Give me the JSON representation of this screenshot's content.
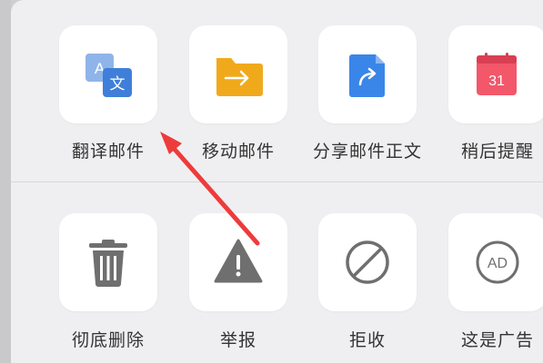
{
  "actions_row1": [
    {
      "label": "翻译邮件",
      "icon": "translate-icon"
    },
    {
      "label": "移动邮件",
      "icon": "move-folder-icon"
    },
    {
      "label": "分享邮件正文",
      "icon": "share-document-icon"
    },
    {
      "label": "稍后提醒",
      "icon": "calendar-icon"
    }
  ],
  "actions_row2": [
    {
      "label": "彻底删除",
      "icon": "trash-icon"
    },
    {
      "label": "举报",
      "icon": "warning-icon"
    },
    {
      "label": "拒收",
      "icon": "block-icon"
    },
    {
      "label": "这是广告",
      "icon": "ad-icon"
    }
  ],
  "icons": {
    "translate": {
      "letter_a": "A",
      "letter_wen": "文"
    },
    "calendar": {
      "day": "31"
    },
    "ad": {
      "text": "AD"
    }
  },
  "colors": {
    "translate_light": "#8fb4ea",
    "translate_dark": "#3f7fd9",
    "folder": "#f1a91c",
    "share": "#3a86e8",
    "calendar": "#f2576a",
    "gray_icon": "#6f6f6f",
    "annotation_arrow": "#ee3b3b"
  }
}
